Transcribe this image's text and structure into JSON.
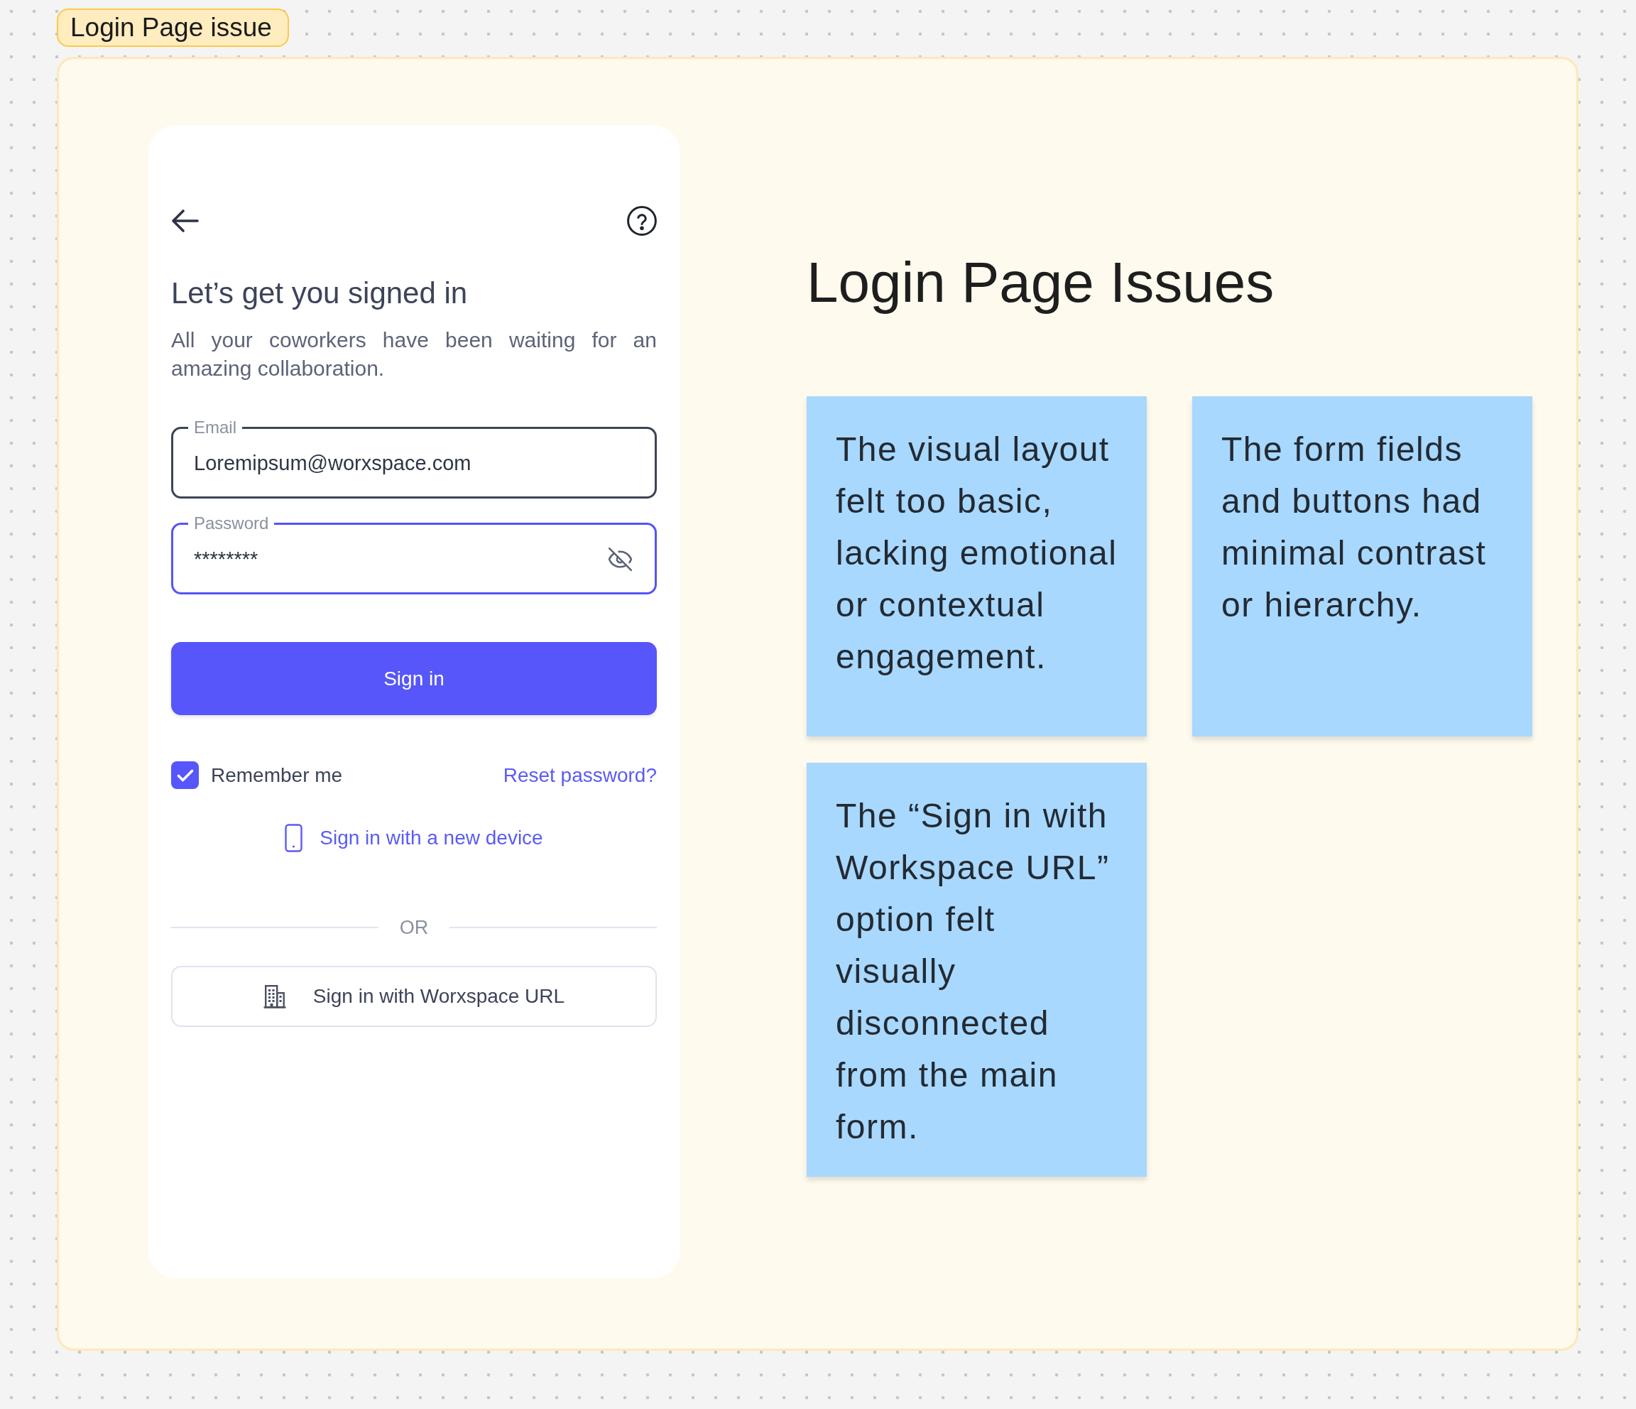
{
  "section": {
    "label": "Login Page issue"
  },
  "login_screen": {
    "title": "Let’s get you signed in",
    "subtitle": "All your coworkers have been waiting for an amazing collaboration.",
    "fields": [
      {
        "kind": "text",
        "label": "Email",
        "value": "Loremipsum@worxspace.com",
        "focused": false
      },
      {
        "kind": "password",
        "label": "Password",
        "value": "********",
        "focused": true
      }
    ],
    "sign_in_button": "Sign in",
    "remember_me": {
      "label": "Remember me",
      "checked": true
    },
    "reset_link": "Reset password?",
    "new_device_link": "Sign in with a new device",
    "divider": "OR",
    "workspace_button": "Sign in with Worxspace URL"
  },
  "board": {
    "title": "Login Page Issues",
    "notes": [
      {
        "text": "The visual layout felt too basic, lacking emotional or contextual engagement."
      },
      {
        "text": "The form fields and buttons had minimal contrast or hierarchy."
      },
      {
        "text": "The “Sign in with Workspace URL” option felt visually disconnected from the main form."
      }
    ]
  }
}
